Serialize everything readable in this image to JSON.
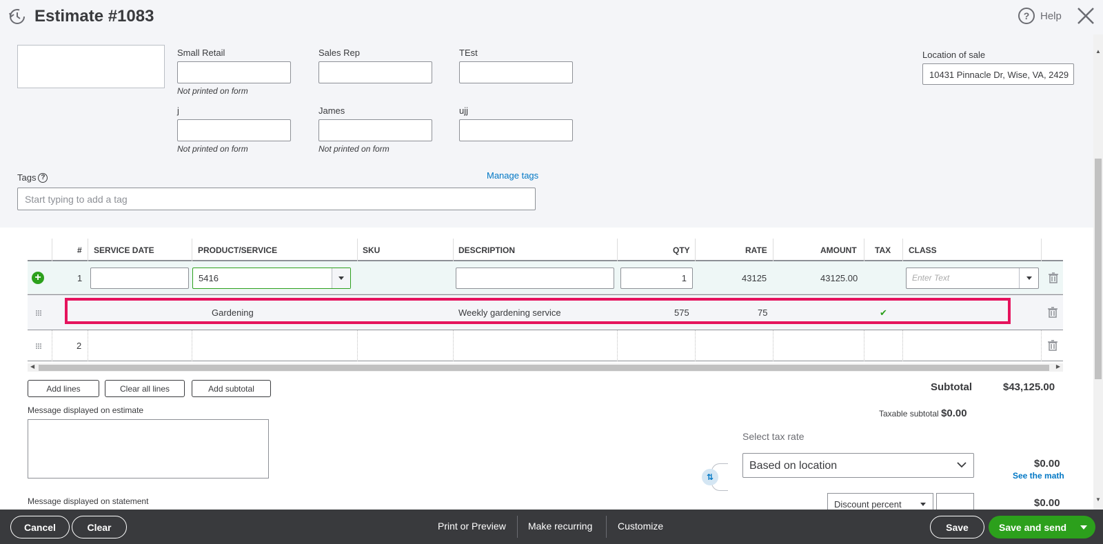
{
  "header": {
    "title": "Estimate #1083",
    "help_label": "Help"
  },
  "custom_fields": {
    "row1": [
      {
        "label": "Small Retail",
        "note": "Not printed on form"
      },
      {
        "label": "Sales Rep",
        "note": ""
      },
      {
        "label": "TEst",
        "note": ""
      }
    ],
    "row2": [
      {
        "label": "j",
        "note": "Not printed on form"
      },
      {
        "label": "James",
        "note": "Not printed on form"
      },
      {
        "label": "ujj",
        "note": ""
      }
    ]
  },
  "location": {
    "label": "Location of sale",
    "value": "10431 Pinnacle Dr, Wise, VA, 2429"
  },
  "tags": {
    "label": "Tags",
    "manage_label": "Manage tags",
    "placeholder": "Start typing to add a tag"
  },
  "table": {
    "headers": [
      "#",
      "SERVICE DATE",
      "PRODUCT/SERVICE",
      "SKU",
      "DESCRIPTION",
      "QTY",
      "RATE",
      "AMOUNT",
      "TAX",
      "CLASS"
    ],
    "row1": {
      "num": "1",
      "service_date": "",
      "product": "5416",
      "description": "",
      "qty": "1",
      "rate": "43125",
      "amount": "43125.00",
      "class_placeholder": "Enter Text"
    },
    "sub_row": {
      "product": "Gardening",
      "description": "Weekly gardening service",
      "qty": "575",
      "rate": "75",
      "tax": "checked"
    },
    "row2": {
      "num": "2"
    }
  },
  "actions": {
    "add_lines": "Add lines",
    "clear_all": "Clear all lines",
    "add_subtotal": "Add subtotal"
  },
  "messages": {
    "estimate_label": "Message displayed on estimate",
    "statement_label": "Message displayed on statement"
  },
  "totals": {
    "subtotal_label": "Subtotal",
    "subtotal_value": "$43,125.00",
    "taxable_label": "Taxable subtotal",
    "taxable_value": "$0.00",
    "select_tax_label": "Select tax rate",
    "tax_rate_value": "Based on location",
    "tax_amount": "$0.00",
    "see_math": "See the math",
    "discount_type": "Discount percent",
    "discount_amount": "$0.00"
  },
  "footer": {
    "cancel": "Cancel",
    "clear": "Clear",
    "print_preview": "Print or Preview",
    "make_recurring": "Make recurring",
    "customize": "Customize",
    "save": "Save",
    "save_and_send": "Save and send"
  },
  "colors": {
    "accent_green": "#2ca01c",
    "link_blue": "#0077c5",
    "highlight": "#e5135d",
    "footer_bg": "#393a3d"
  }
}
